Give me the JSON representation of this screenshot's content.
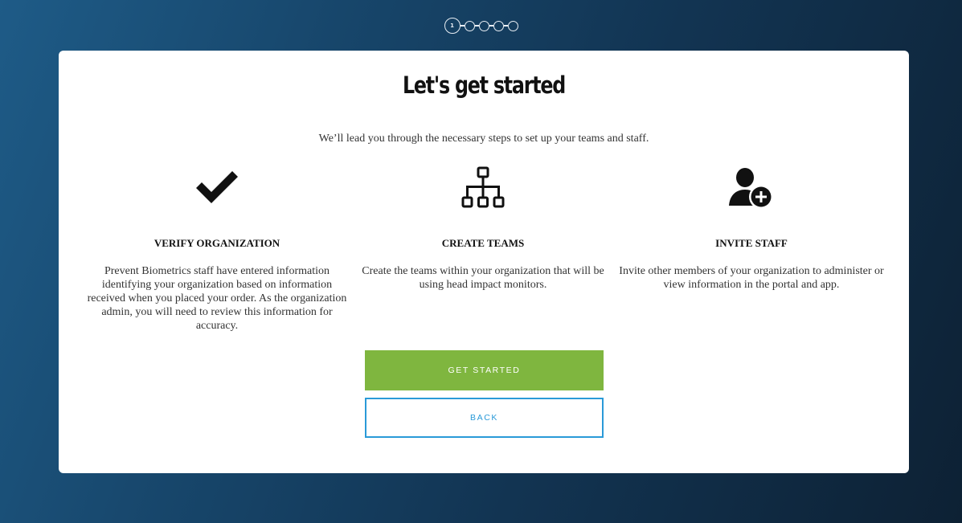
{
  "stepper": {
    "current_step_label": "1",
    "total_steps": 5,
    "current_step": 1
  },
  "card": {
    "title": "Let's get started",
    "subtitle": "We’ll lead you through the necessary steps to set up your teams and staff."
  },
  "features": [
    {
      "icon": "checkmark-icon",
      "heading": "VERIFY ORGANIZATION",
      "body": "Prevent Biometrics staff have entered information identifying your organization based on information received when you placed your order. As the organization admin, you will need to review this information for accuracy."
    },
    {
      "icon": "org-chart-icon",
      "heading": "CREATE TEAMS",
      "body": "Create the teams within your organization that will be using head impact monitors."
    },
    {
      "icon": "add-user-icon",
      "heading": "INVITE STAFF",
      "body": "Invite other members of your organization to administer or view information in the portal and app."
    }
  ],
  "actions": {
    "primary_label": "GET STARTED",
    "secondary_label": "BACK"
  },
  "colors": {
    "primary_button": "#7fb63f",
    "secondary_button": "#2a9ad8",
    "background_start": "#1e5b87",
    "background_end": "#0d2134"
  }
}
